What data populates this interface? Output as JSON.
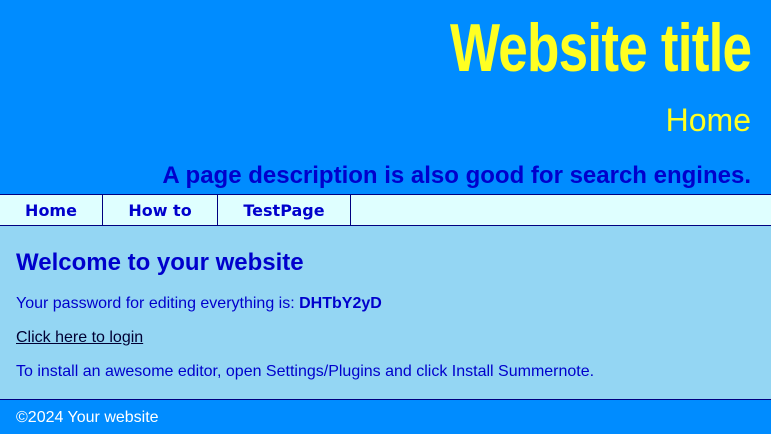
{
  "header": {
    "site_title": "Website title",
    "page_name": "Home",
    "description": "A page description is also good for search engines."
  },
  "nav": {
    "items": [
      "Home",
      "How to",
      "TestPage"
    ]
  },
  "content": {
    "heading": "Welcome to your website",
    "password_text": "Your password for editing everything is: ",
    "password_value": "DHTbY2yD",
    "login_link": "Click here to login",
    "install_text": "To install an awesome editor, open Settings/Plugins and click Install Summernote."
  },
  "footer": {
    "text": "©2024 Your website"
  },
  "colors": {
    "header_bg": "#008cff",
    "title": "#ffff22",
    "text": "#0000cc",
    "nav_bg": "#dfffff",
    "content_bg": "#94d6f3"
  }
}
